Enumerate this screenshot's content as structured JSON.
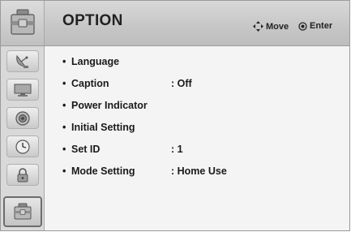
{
  "header": {
    "title": "OPTION",
    "move_label": "Move",
    "enter_label": "Enter"
  },
  "sidebar": {
    "items": [
      {
        "icon": "satellite-dish-icon"
      },
      {
        "icon": "monitor-icon"
      },
      {
        "icon": "speaker-icon"
      },
      {
        "icon": "clock-icon"
      },
      {
        "icon": "lock-icon"
      },
      {
        "icon": "toolbox-icon",
        "active": true
      }
    ]
  },
  "menu": {
    "bullet": "•",
    "items": [
      {
        "label": "Language",
        "value": ""
      },
      {
        "label": "Caption",
        "value": ": Off"
      },
      {
        "label": "Power Indicator",
        "value": ""
      },
      {
        "label": "Initial Setting",
        "value": ""
      },
      {
        "label": "Set ID",
        "value": ": 1"
      },
      {
        "label": "Mode Setting",
        "value": ": Home Use"
      }
    ]
  },
  "colors": {
    "header_bg": "#c6c6c6",
    "panel_bg": "#f4f4f4",
    "sidebar_bg": "#d9d9d9",
    "active_border": "#6c6c6c"
  }
}
